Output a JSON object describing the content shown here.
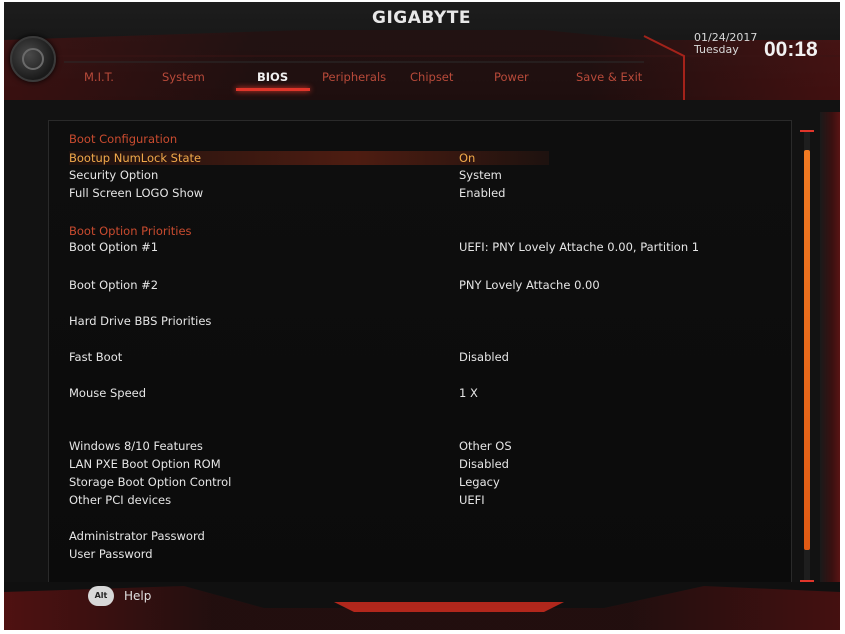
{
  "header": {
    "brand": "GIGABYTE",
    "date": "01/24/2017",
    "day": "Tuesday",
    "time": "00:18",
    "tabs": [
      {
        "label": "M.I.T."
      },
      {
        "label": "System"
      },
      {
        "label": "BIOS"
      },
      {
        "label": "Peripherals"
      },
      {
        "label": "Chipset"
      },
      {
        "label": "Power"
      },
      {
        "label": "Save & Exit"
      }
    ],
    "active_tab": "BIOS"
  },
  "settings": {
    "boot_configuration_heading": "Boot Configuration",
    "bootup_numlock": {
      "label": "Bootup NumLock State",
      "value": "On"
    },
    "security_option": {
      "label": "Security Option",
      "value": "System"
    },
    "full_screen_logo": {
      "label": "Full Screen LOGO Show",
      "value": "Enabled"
    },
    "boot_option_priorities_heading": "Boot Option Priorities",
    "boot_option_1": {
      "label": "Boot Option #1",
      "value": "UEFI: PNY Lovely Attache 0.00, Partition 1"
    },
    "boot_option_2": {
      "label": "Boot Option #2",
      "value": "PNY Lovely Attache 0.00"
    },
    "hdd_bbs": {
      "label": "Hard Drive BBS Priorities"
    },
    "fast_boot": {
      "label": "Fast Boot",
      "value": "Disabled"
    },
    "mouse_speed": {
      "label": "Mouse Speed",
      "value": "1 X"
    },
    "windows_features": {
      "label": "Windows 8/10 Features",
      "value": "Other OS"
    },
    "lan_pxe": {
      "label": "LAN PXE Boot Option ROM",
      "value": "Disabled"
    },
    "storage_boot": {
      "label": "Storage Boot Option Control",
      "value": "Legacy"
    },
    "other_pci": {
      "label": "Other PCI devices",
      "value": "UEFI"
    },
    "admin_password": {
      "label": "Administrator Password"
    },
    "user_password": {
      "label": "User Password"
    }
  },
  "footer": {
    "alt_key": "Alt",
    "help_label": "Help"
  },
  "colors": {
    "accent_red": "#e0352a",
    "section_heading": "#c94b2f",
    "highlight_text": "#f0a94a",
    "scroll_thumb": "#f07a22"
  }
}
